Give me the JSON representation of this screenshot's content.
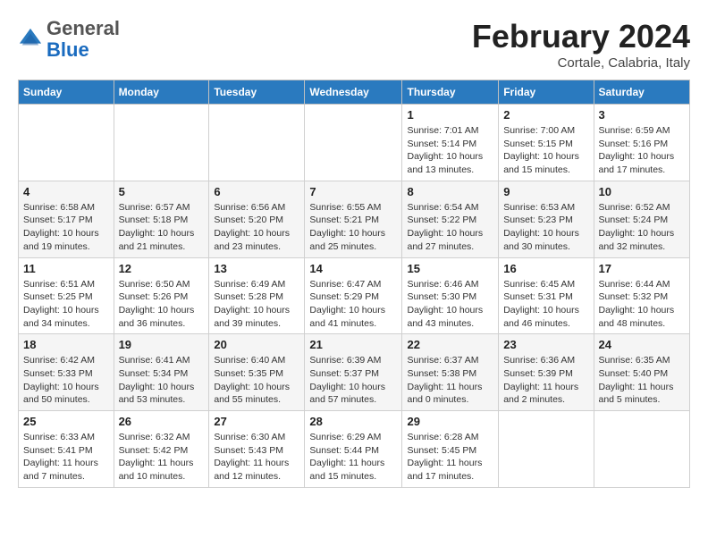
{
  "header": {
    "logo_general": "General",
    "logo_blue": "Blue",
    "month_title": "February 2024",
    "location": "Cortale, Calabria, Italy"
  },
  "days_of_week": [
    "Sunday",
    "Monday",
    "Tuesday",
    "Wednesday",
    "Thursday",
    "Friday",
    "Saturday"
  ],
  "weeks": [
    [
      {
        "day": "",
        "info": ""
      },
      {
        "day": "",
        "info": ""
      },
      {
        "day": "",
        "info": ""
      },
      {
        "day": "",
        "info": ""
      },
      {
        "day": "1",
        "sunrise": "Sunrise: 7:01 AM",
        "sunset": "Sunset: 5:14 PM",
        "daylight": "Daylight: 10 hours and 13 minutes."
      },
      {
        "day": "2",
        "sunrise": "Sunrise: 7:00 AM",
        "sunset": "Sunset: 5:15 PM",
        "daylight": "Daylight: 10 hours and 15 minutes."
      },
      {
        "day": "3",
        "sunrise": "Sunrise: 6:59 AM",
        "sunset": "Sunset: 5:16 PM",
        "daylight": "Daylight: 10 hours and 17 minutes."
      }
    ],
    [
      {
        "day": "4",
        "sunrise": "Sunrise: 6:58 AM",
        "sunset": "Sunset: 5:17 PM",
        "daylight": "Daylight: 10 hours and 19 minutes."
      },
      {
        "day": "5",
        "sunrise": "Sunrise: 6:57 AM",
        "sunset": "Sunset: 5:18 PM",
        "daylight": "Daylight: 10 hours and 21 minutes."
      },
      {
        "day": "6",
        "sunrise": "Sunrise: 6:56 AM",
        "sunset": "Sunset: 5:20 PM",
        "daylight": "Daylight: 10 hours and 23 minutes."
      },
      {
        "day": "7",
        "sunrise": "Sunrise: 6:55 AM",
        "sunset": "Sunset: 5:21 PM",
        "daylight": "Daylight: 10 hours and 25 minutes."
      },
      {
        "day": "8",
        "sunrise": "Sunrise: 6:54 AM",
        "sunset": "Sunset: 5:22 PM",
        "daylight": "Daylight: 10 hours and 27 minutes."
      },
      {
        "day": "9",
        "sunrise": "Sunrise: 6:53 AM",
        "sunset": "Sunset: 5:23 PM",
        "daylight": "Daylight: 10 hours and 30 minutes."
      },
      {
        "day": "10",
        "sunrise": "Sunrise: 6:52 AM",
        "sunset": "Sunset: 5:24 PM",
        "daylight": "Daylight: 10 hours and 32 minutes."
      }
    ],
    [
      {
        "day": "11",
        "sunrise": "Sunrise: 6:51 AM",
        "sunset": "Sunset: 5:25 PM",
        "daylight": "Daylight: 10 hours and 34 minutes."
      },
      {
        "day": "12",
        "sunrise": "Sunrise: 6:50 AM",
        "sunset": "Sunset: 5:26 PM",
        "daylight": "Daylight: 10 hours and 36 minutes."
      },
      {
        "day": "13",
        "sunrise": "Sunrise: 6:49 AM",
        "sunset": "Sunset: 5:28 PM",
        "daylight": "Daylight: 10 hours and 39 minutes."
      },
      {
        "day": "14",
        "sunrise": "Sunrise: 6:47 AM",
        "sunset": "Sunset: 5:29 PM",
        "daylight": "Daylight: 10 hours and 41 minutes."
      },
      {
        "day": "15",
        "sunrise": "Sunrise: 6:46 AM",
        "sunset": "Sunset: 5:30 PM",
        "daylight": "Daylight: 10 hours and 43 minutes."
      },
      {
        "day": "16",
        "sunrise": "Sunrise: 6:45 AM",
        "sunset": "Sunset: 5:31 PM",
        "daylight": "Daylight: 10 hours and 46 minutes."
      },
      {
        "day": "17",
        "sunrise": "Sunrise: 6:44 AM",
        "sunset": "Sunset: 5:32 PM",
        "daylight": "Daylight: 10 hours and 48 minutes."
      }
    ],
    [
      {
        "day": "18",
        "sunrise": "Sunrise: 6:42 AM",
        "sunset": "Sunset: 5:33 PM",
        "daylight": "Daylight: 10 hours and 50 minutes."
      },
      {
        "day": "19",
        "sunrise": "Sunrise: 6:41 AM",
        "sunset": "Sunset: 5:34 PM",
        "daylight": "Daylight: 10 hours and 53 minutes."
      },
      {
        "day": "20",
        "sunrise": "Sunrise: 6:40 AM",
        "sunset": "Sunset: 5:35 PM",
        "daylight": "Daylight: 10 hours and 55 minutes."
      },
      {
        "day": "21",
        "sunrise": "Sunrise: 6:39 AM",
        "sunset": "Sunset: 5:37 PM",
        "daylight": "Daylight: 10 hours and 57 minutes."
      },
      {
        "day": "22",
        "sunrise": "Sunrise: 6:37 AM",
        "sunset": "Sunset: 5:38 PM",
        "daylight": "Daylight: 11 hours and 0 minutes."
      },
      {
        "day": "23",
        "sunrise": "Sunrise: 6:36 AM",
        "sunset": "Sunset: 5:39 PM",
        "daylight": "Daylight: 11 hours and 2 minutes."
      },
      {
        "day": "24",
        "sunrise": "Sunrise: 6:35 AM",
        "sunset": "Sunset: 5:40 PM",
        "daylight": "Daylight: 11 hours and 5 minutes."
      }
    ],
    [
      {
        "day": "25",
        "sunrise": "Sunrise: 6:33 AM",
        "sunset": "Sunset: 5:41 PM",
        "daylight": "Daylight: 11 hours and 7 minutes."
      },
      {
        "day": "26",
        "sunrise": "Sunrise: 6:32 AM",
        "sunset": "Sunset: 5:42 PM",
        "daylight": "Daylight: 11 hours and 10 minutes."
      },
      {
        "day": "27",
        "sunrise": "Sunrise: 6:30 AM",
        "sunset": "Sunset: 5:43 PM",
        "daylight": "Daylight: 11 hours and 12 minutes."
      },
      {
        "day": "28",
        "sunrise": "Sunrise: 6:29 AM",
        "sunset": "Sunset: 5:44 PM",
        "daylight": "Daylight: 11 hours and 15 minutes."
      },
      {
        "day": "29",
        "sunrise": "Sunrise: 6:28 AM",
        "sunset": "Sunset: 5:45 PM",
        "daylight": "Daylight: 11 hours and 17 minutes."
      },
      {
        "day": "",
        "info": ""
      },
      {
        "day": "",
        "info": ""
      }
    ]
  ]
}
